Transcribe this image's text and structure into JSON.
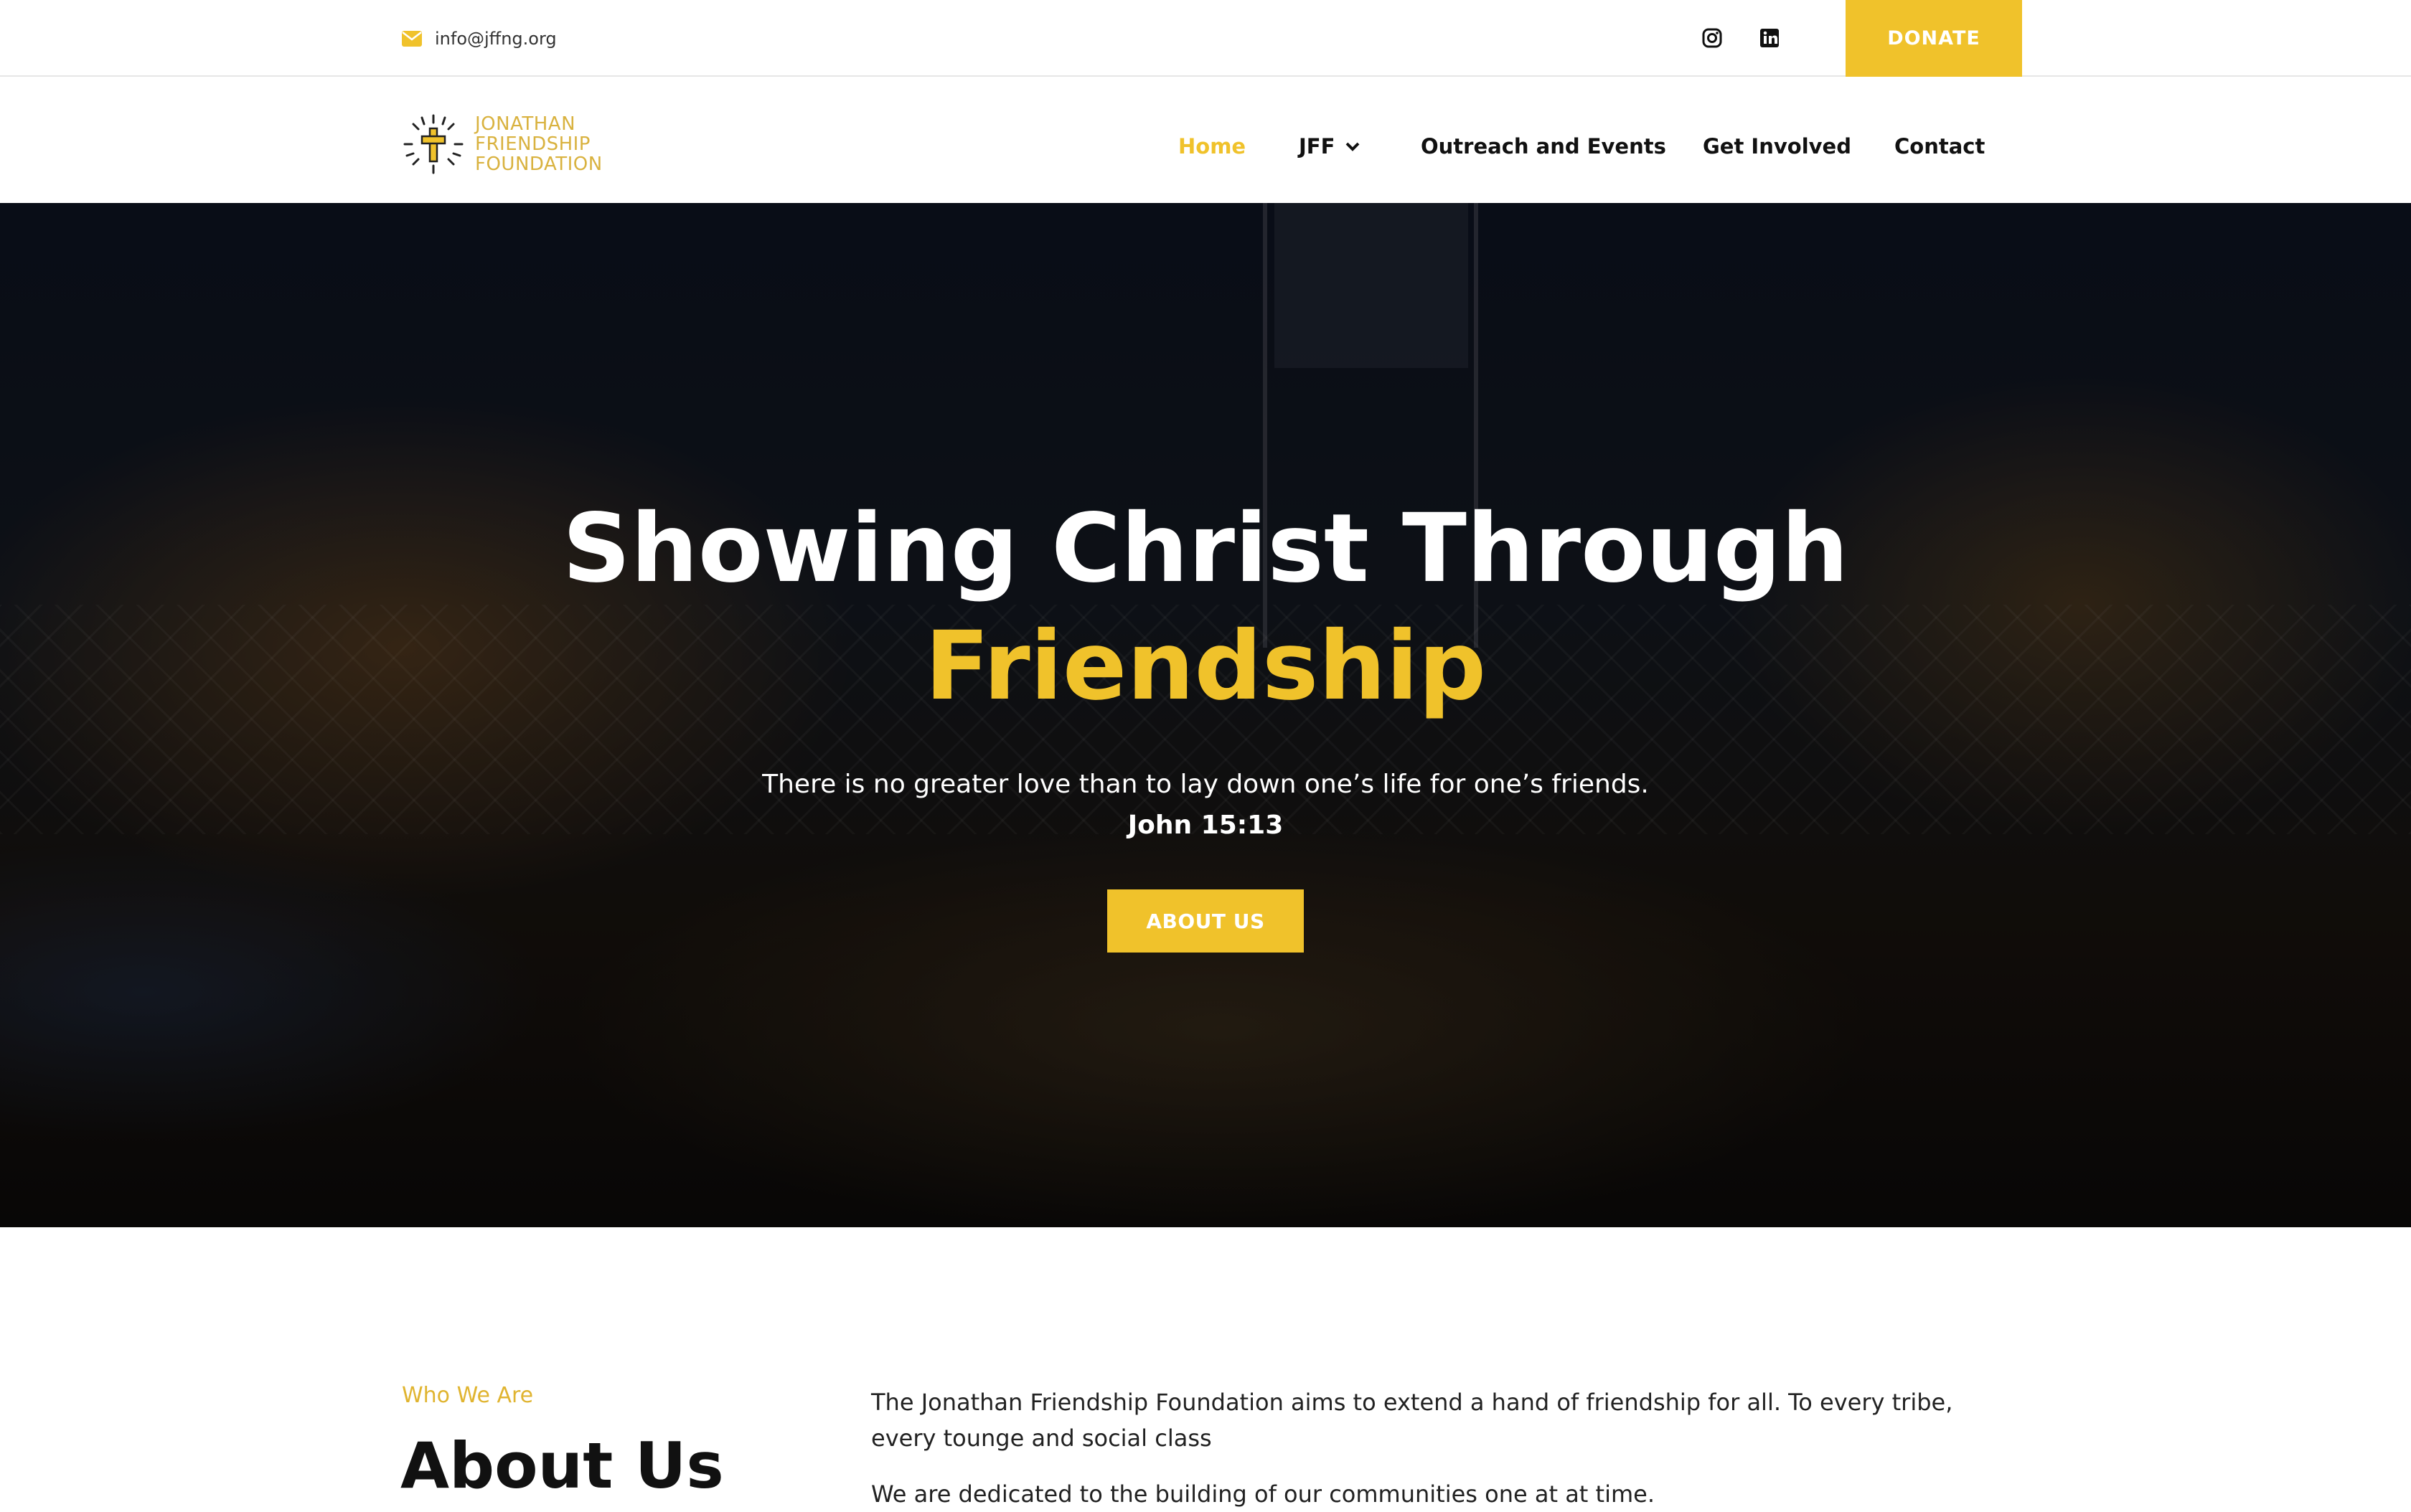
{
  "topbar": {
    "email": "info@jffng.org",
    "icons": [
      "envelope-icon",
      "instagram-icon",
      "linkedin-icon"
    ],
    "donate_label": "DONATE"
  },
  "logo": {
    "line1": "JONATHAN",
    "line2": "FRIENDSHIP",
    "line3": "FOUNDATION"
  },
  "nav": {
    "items": [
      {
        "label": "Home",
        "active": true
      },
      {
        "label": "JFF",
        "has_dropdown": true
      },
      {
        "label": "Outreach and Events"
      },
      {
        "label": "Get Involved"
      },
      {
        "label": "Contact"
      }
    ]
  },
  "hero": {
    "title_line1": "Showing Christ Through",
    "title_line2": "Friendship",
    "quote": "There is no greater love than to lay down one’s life for one’s friends.",
    "reference": "John 15:13",
    "cta_label": "ABOUT US"
  },
  "about": {
    "kicker": "Who We Are",
    "title": "About Us",
    "paragraph1": "The Jonathan Friendship Foundation aims to extend a hand of friendship for all. To every tribe, every tounge and social class",
    "paragraph2": "We are dedicated to the building of our communities one at at time."
  },
  "colors": {
    "accent": "#f0c22b",
    "logo_gold": "#d9b23f",
    "text_dark": "#111111"
  }
}
